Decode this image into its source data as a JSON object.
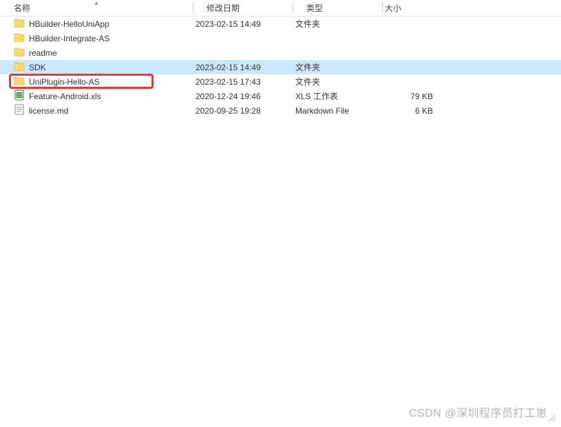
{
  "columns": {
    "name": "名称",
    "date": "修改日期",
    "type": "类型",
    "size": "大小"
  },
  "rows": [
    {
      "name": "HBuilder-HelloUniApp",
      "date": "2023-02-15 14:49",
      "type": "文件夹",
      "size": "",
      "icon": "folder",
      "selected": false,
      "highlight": false
    },
    {
      "name": "HBuilder-Integrate-AS",
      "date": "",
      "type": "",
      "size": "",
      "icon": "folder",
      "selected": false,
      "highlight": false
    },
    {
      "name": "readme",
      "date": "",
      "type": "",
      "size": "",
      "icon": "folder",
      "selected": false,
      "highlight": false
    },
    {
      "name": "SDK",
      "date": "2023-02-15 14:49",
      "type": "文件夹",
      "size": "",
      "icon": "folder",
      "selected": true,
      "highlight": false
    },
    {
      "name": "UniPlugin-Hello-AS",
      "date": "2023-02-15 17:43",
      "type": "文件夹",
      "size": "",
      "icon": "folder",
      "selected": false,
      "highlight": true
    },
    {
      "name": "Feature-Android.xls",
      "date": "2020-12-24 19:46",
      "type": "XLS 工作表",
      "size": "79 KB",
      "icon": "xls",
      "selected": false,
      "highlight": false
    },
    {
      "name": "license.md",
      "date": "2020-09-25 19:28",
      "type": "Markdown File",
      "size": "6 KB",
      "icon": "md",
      "selected": false,
      "highlight": false
    }
  ],
  "watermark": "CSDN @深圳程序员打工崽"
}
